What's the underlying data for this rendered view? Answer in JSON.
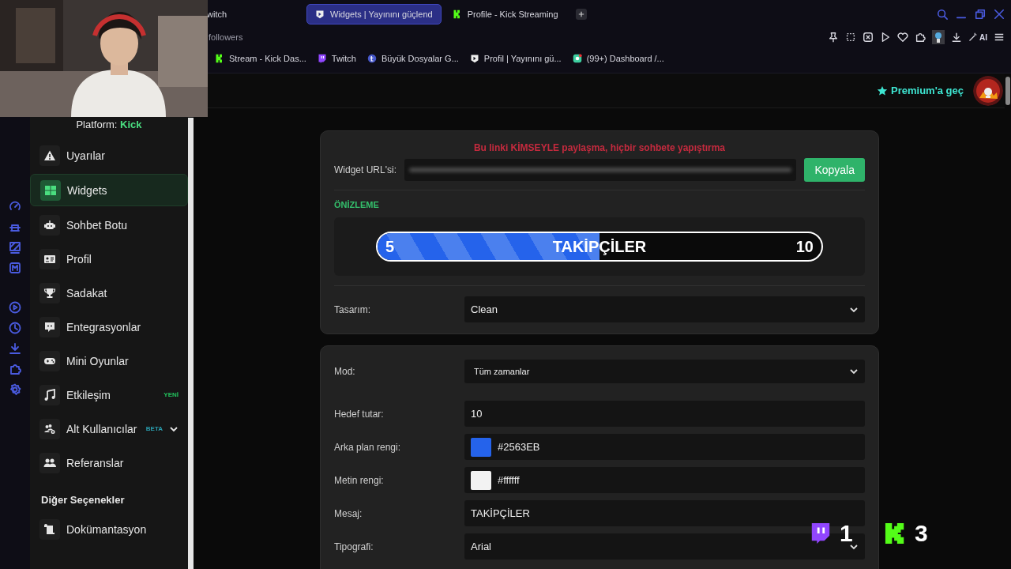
{
  "browser": {
    "tabs": [
      {
        "label": "witch",
        "selected": false
      },
      {
        "label": "Widgets | Yayınını güçlend",
        "selected": true
      },
      {
        "label": "Profile - Kick Streaming",
        "selected": false
      }
    ],
    "address": "followers",
    "ai_label": "AI",
    "bookmarks": [
      "Stream - Kick Das...",
      "Twitch",
      "Büyük Dosyalar G...",
      "Profil | Yayınını gü...",
      "(99+) Dashboard /..."
    ]
  },
  "header": {
    "premium": "Premium'a geç"
  },
  "sidebar": {
    "platform_label": "Platform:",
    "platform": "Kick",
    "items": [
      {
        "label": "Uyarılar",
        "selected": false,
        "kind": "link"
      },
      {
        "label": "Widgets",
        "selected": true,
        "kind": "link"
      },
      {
        "label": "Sohbet Botu",
        "selected": false,
        "kind": "link"
      },
      {
        "label": "Profil",
        "selected": false,
        "kind": "link"
      },
      {
        "label": "Sadakat",
        "selected": false,
        "kind": "link"
      },
      {
        "label": "Entegrasyonlar",
        "selected": false,
        "kind": "link"
      },
      {
        "label": "Mini Oyunlar",
        "selected": false,
        "kind": "link"
      },
      {
        "label": "Etkileşim",
        "selected": false,
        "kind": "link",
        "badge": {
          "text": "YENİ",
          "color": "#22c55e"
        }
      },
      {
        "label": "Alt Kullanıcılar",
        "selected": false,
        "kind": "group",
        "badge": {
          "text": "BETA",
          "color": "#2a9fb0"
        }
      },
      {
        "label": "Referanslar",
        "selected": false,
        "kind": "link"
      }
    ],
    "section": "Diğer Seçenekler",
    "more_items": [
      {
        "label": "Dokümantasyon",
        "selected": false,
        "kind": "link"
      }
    ]
  },
  "widget_card": {
    "warning": "Bu linki KİMSEYLE paylaşma, hiçbir sohbete yapıştırma",
    "url_label": "Widget URL'si:",
    "copy_button": "Kopyala",
    "preview_label": "ÖNİZLEME",
    "preview": {
      "min": "5",
      "max": "10",
      "message": "TAKİPÇİLER",
      "level": 0.5
    },
    "design": {
      "label": "Tasarım:",
      "value": "Clean"
    }
  },
  "settings": [
    {
      "kind": "select",
      "label": "Mod:",
      "value": "Tüm zamanlar"
    },
    {
      "kind": "text",
      "label": "Hedef tutar:",
      "value": "10"
    },
    {
      "kind": "color",
      "label": "Arka plan rengi:",
      "value": "#2563EB",
      "color": "#2563eb"
    },
    {
      "kind": "color",
      "label": "Metin rengi:",
      "value": "#ffffff",
      "color": "#f2f2f2"
    },
    {
      "kind": "text",
      "label": "Mesaj:",
      "value": "TAKİPÇİLER"
    },
    {
      "kind": "select",
      "label": "Tipografi:",
      "value": "Arial"
    }
  ],
  "stream_counts": [
    {
      "kind": "twitch",
      "count": "1"
    },
    {
      "kind": "kick",
      "count": "3"
    }
  ]
}
